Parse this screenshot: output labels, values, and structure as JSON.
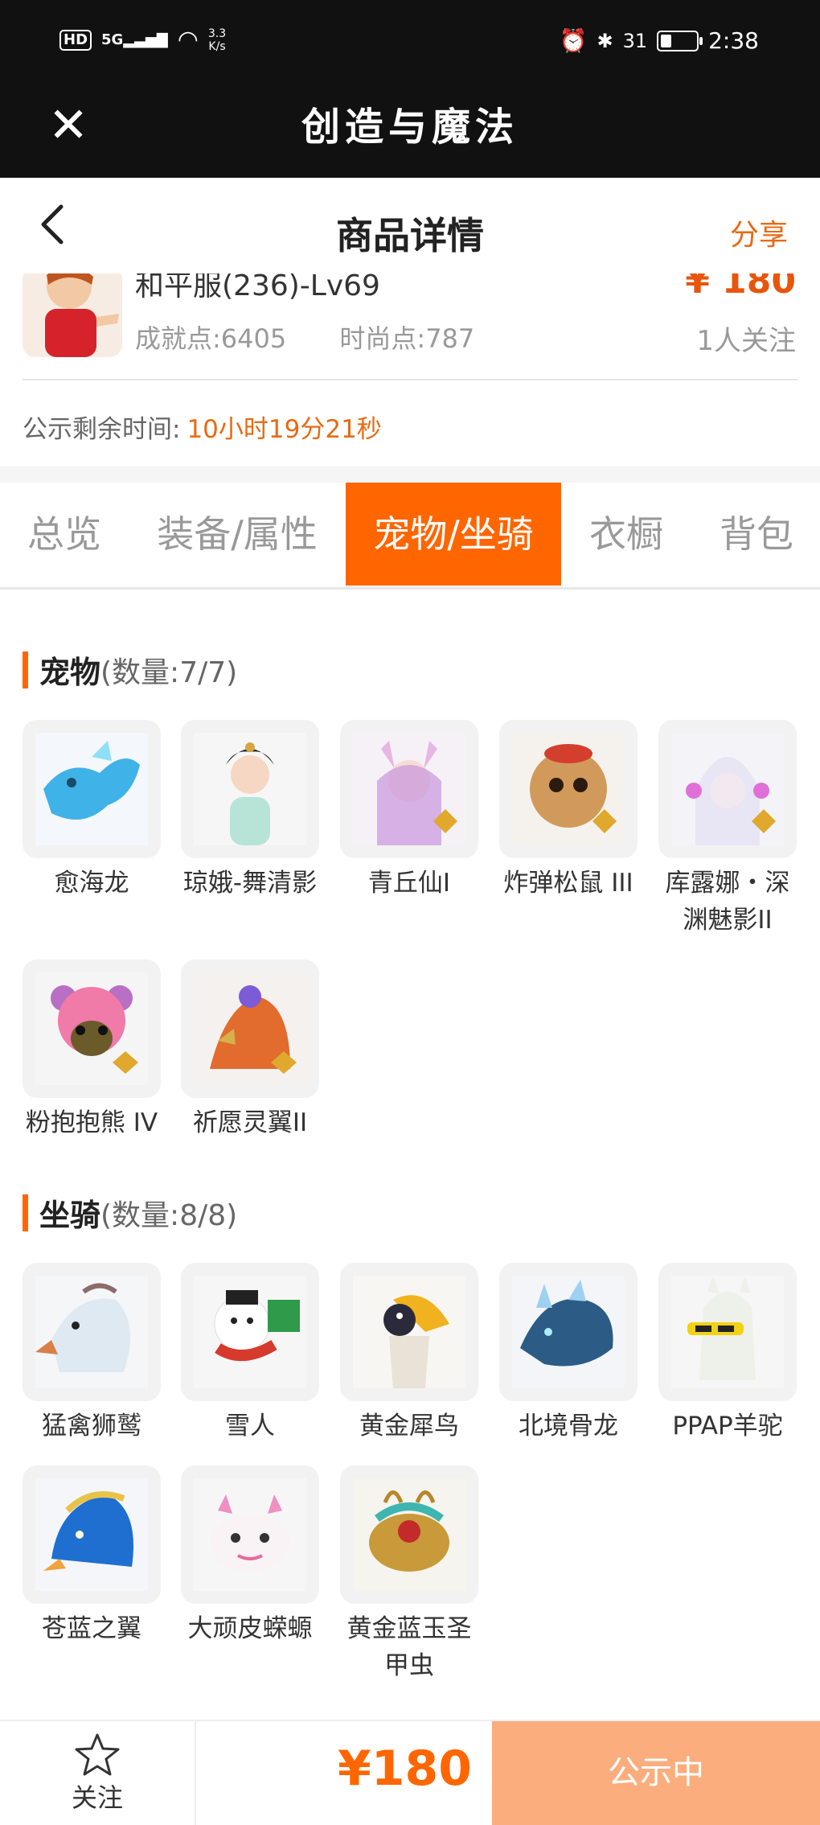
{
  "status_bar": {
    "hd": "HD",
    "signal": "5G",
    "net_speed_value": "3.3",
    "net_speed_unit": "K/s",
    "battery": "31",
    "battery_level": 0.31,
    "time": "2:38"
  },
  "app_bar": {
    "title": "创造与魔法"
  },
  "nav": {
    "title": "商品详情",
    "share": "分享"
  },
  "product": {
    "name": "和平服(236)-Lv69",
    "price": "¥ 180",
    "achievement": "成就点:6405",
    "fashion": "时尚点:787",
    "watchers": "1人关注",
    "countdown_label": "公示剩余时间:",
    "countdown_value": "10小时19分21秒"
  },
  "tabs": [
    {
      "label": "总览"
    },
    {
      "label": "装备/属性"
    },
    {
      "label": "宠物/坐骑"
    },
    {
      "label": "衣橱"
    },
    {
      "label": "背包"
    }
  ],
  "pets_section": {
    "title": "宠物",
    "count": "(数量:7/7)",
    "items": [
      {
        "name": "愈海龙",
        "icon": "dragon-icon"
      },
      {
        "name": "琼娥-舞清影",
        "icon": "dancer-icon"
      },
      {
        "name": "青丘仙I",
        "icon": "fox-fairy-icon"
      },
      {
        "name": "炸弹松鼠 III",
        "icon": "squirrel-icon"
      },
      {
        "name": "库露娜・深渊魅影II",
        "icon": "phantom-icon"
      },
      {
        "name": "粉抱抱熊 IV",
        "icon": "bear-icon"
      },
      {
        "name": "祈愿灵翼II",
        "icon": "bird-icon"
      }
    ]
  },
  "mounts_section": {
    "title": "坐骑",
    "count": "(数量:8/8)",
    "items": [
      {
        "name": "猛禽狮鹫",
        "icon": "griffin-icon"
      },
      {
        "name": "雪人",
        "icon": "snowman-icon"
      },
      {
        "name": "黄金犀鸟",
        "icon": "hornbill-icon"
      },
      {
        "name": "北境骨龙",
        "icon": "bone-dragon-icon"
      },
      {
        "name": "PPAP羊驼",
        "icon": "alpaca-icon"
      },
      {
        "name": "苍蓝之翼",
        "icon": "blue-wing-icon"
      },
      {
        "name": "大顽皮蝾螈",
        "icon": "axolotl-icon"
      },
      {
        "name": "黄金蓝玉圣甲虫",
        "icon": "scarab-icon"
      }
    ]
  },
  "bottom_bar": {
    "follow": "关注",
    "price": "¥180",
    "status": "公示中"
  },
  "colors": {
    "accent": "#ff6600",
    "price": "#e8550c",
    "status_button": "#fbad7d"
  }
}
